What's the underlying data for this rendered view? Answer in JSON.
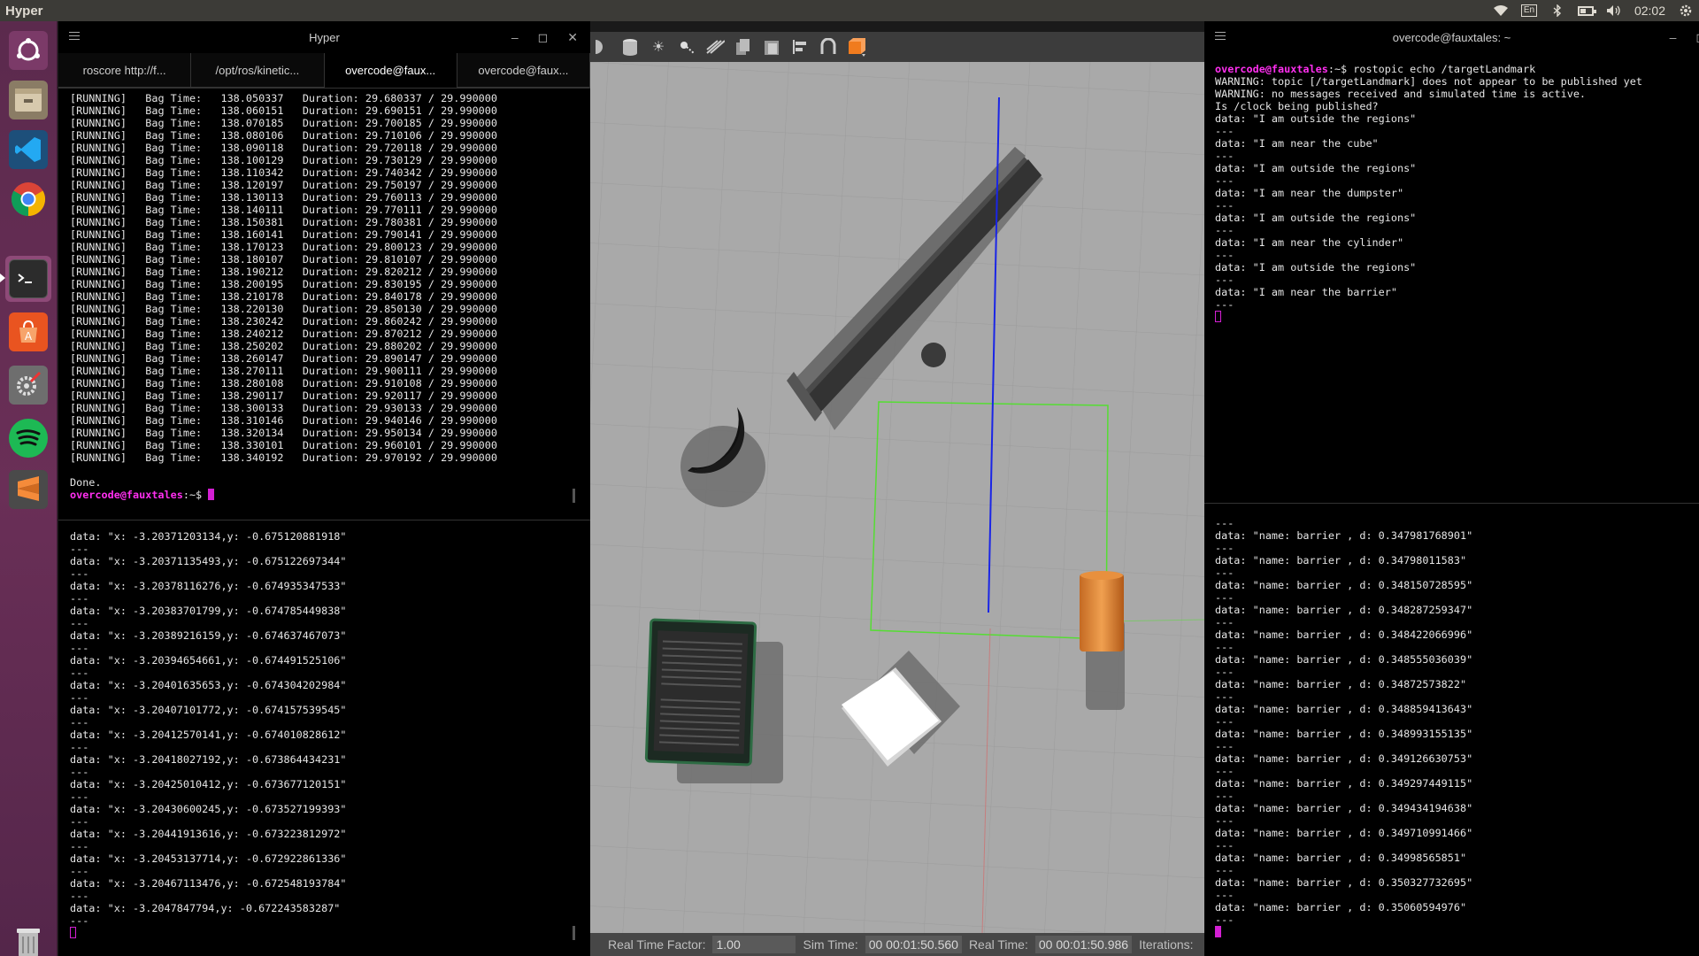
{
  "topbar": {
    "app_name": "Hyper",
    "time": "02:02",
    "keyboard": "En"
  },
  "launcher": {
    "items": [
      {
        "name": "ubuntu-dash-icon",
        "color": "#e95420"
      },
      {
        "name": "files-icon",
        "color": "#c8b99a"
      },
      {
        "name": "vscode-icon",
        "color": "#23a9f2"
      },
      {
        "name": "chrome-icon",
        "color": "#4285f4"
      },
      {
        "name": "terminal-icon",
        "color": "#2c2c2c"
      },
      {
        "name": "software-center-icon",
        "color": "#e95420"
      },
      {
        "name": "system-settings-icon",
        "color": "#9a9a9a"
      },
      {
        "name": "spotify-icon",
        "color": "#1db954"
      },
      {
        "name": "sublime-icon",
        "color": "#f58b3a"
      },
      {
        "name": "trash-icon",
        "color": "#cfcfcf"
      }
    ]
  },
  "left_window": {
    "title": "Hyper",
    "tabs": [
      {
        "label": "roscore http://f..."
      },
      {
        "label": "/opt/ros/kinetic..."
      },
      {
        "label": "overcode@faux..."
      },
      {
        "label": "overcode@faux..."
      }
    ],
    "top_pane": {
      "rows": [
        {
          "status": "[RUNNING]",
          "bag_label": "Bag Time:",
          "bag": "138.050337",
          "dur_label": "Duration:",
          "dur": "29.680337 / 29.990000"
        },
        {
          "status": "[RUNNING]",
          "bag_label": "Bag Time:",
          "bag": "138.060151",
          "dur_label": "Duration:",
          "dur": "29.690151 / 29.990000"
        },
        {
          "status": "[RUNNING]",
          "bag_label": "Bag Time:",
          "bag": "138.070185",
          "dur_label": "Duration:",
          "dur": "29.700185 / 29.990000"
        },
        {
          "status": "[RUNNING]",
          "bag_label": "Bag Time:",
          "bag": "138.080106",
          "dur_label": "Duration:",
          "dur": "29.710106 / 29.990000"
        },
        {
          "status": "[RUNNING]",
          "bag_label": "Bag Time:",
          "bag": "138.090118",
          "dur_label": "Duration:",
          "dur": "29.720118 / 29.990000"
        },
        {
          "status": "[RUNNING]",
          "bag_label": "Bag Time:",
          "bag": "138.100129",
          "dur_label": "Duration:",
          "dur": "29.730129 / 29.990000"
        },
        {
          "status": "[RUNNING]",
          "bag_label": "Bag Time:",
          "bag": "138.110342",
          "dur_label": "Duration:",
          "dur": "29.740342 / 29.990000"
        },
        {
          "status": "[RUNNING]",
          "bag_label": "Bag Time:",
          "bag": "138.120197",
          "dur_label": "Duration:",
          "dur": "29.750197 / 29.990000"
        },
        {
          "status": "[RUNNING]",
          "bag_label": "Bag Time:",
          "bag": "138.130113",
          "dur_label": "Duration:",
          "dur": "29.760113 / 29.990000"
        },
        {
          "status": "[RUNNING]",
          "bag_label": "Bag Time:",
          "bag": "138.140111",
          "dur_label": "Duration:",
          "dur": "29.770111 / 29.990000"
        },
        {
          "status": "[RUNNING]",
          "bag_label": "Bag Time:",
          "bag": "138.150381",
          "dur_label": "Duration:",
          "dur": "29.780381 / 29.990000"
        },
        {
          "status": "[RUNNING]",
          "bag_label": "Bag Time:",
          "bag": "138.160141",
          "dur_label": "Duration:",
          "dur": "29.790141 / 29.990000"
        },
        {
          "status": "[RUNNING]",
          "bag_label": "Bag Time:",
          "bag": "138.170123",
          "dur_label": "Duration:",
          "dur": "29.800123 / 29.990000"
        },
        {
          "status": "[RUNNING]",
          "bag_label": "Bag Time:",
          "bag": "138.180107",
          "dur_label": "Duration:",
          "dur": "29.810107 / 29.990000"
        },
        {
          "status": "[RUNNING]",
          "bag_label": "Bag Time:",
          "bag": "138.190212",
          "dur_label": "Duration:",
          "dur": "29.820212 / 29.990000"
        },
        {
          "status": "[RUNNING]",
          "bag_label": "Bag Time:",
          "bag": "138.200195",
          "dur_label": "Duration:",
          "dur": "29.830195 / 29.990000"
        },
        {
          "status": "[RUNNING]",
          "bag_label": "Bag Time:",
          "bag": "138.210178",
          "dur_label": "Duration:",
          "dur": "29.840178 / 29.990000"
        },
        {
          "status": "[RUNNING]",
          "bag_label": "Bag Time:",
          "bag": "138.220130",
          "dur_label": "Duration:",
          "dur": "29.850130 / 29.990000"
        },
        {
          "status": "[RUNNING]",
          "bag_label": "Bag Time:",
          "bag": "138.230242",
          "dur_label": "Duration:",
          "dur": "29.860242 / 29.990000"
        },
        {
          "status": "[RUNNING]",
          "bag_label": "Bag Time:",
          "bag": "138.240212",
          "dur_label": "Duration:",
          "dur": "29.870212 / 29.990000"
        },
        {
          "status": "[RUNNING]",
          "bag_label": "Bag Time:",
          "bag": "138.250202",
          "dur_label": "Duration:",
          "dur": "29.880202 / 29.990000"
        },
        {
          "status": "[RUNNING]",
          "bag_label": "Bag Time:",
          "bag": "138.260147",
          "dur_label": "Duration:",
          "dur": "29.890147 / 29.990000"
        },
        {
          "status": "[RUNNING]",
          "bag_label": "Bag Time:",
          "bag": "138.270111",
          "dur_label": "Duration:",
          "dur": "29.900111 / 29.990000"
        },
        {
          "status": "[RUNNING]",
          "bag_label": "Bag Time:",
          "bag": "138.280108",
          "dur_label": "Duration:",
          "dur": "29.910108 / 29.990000"
        },
        {
          "status": "[RUNNING]",
          "bag_label": "Bag Time:",
          "bag": "138.290117",
          "dur_label": "Duration:",
          "dur": "29.920117 / 29.990000"
        },
        {
          "status": "[RUNNING]",
          "bag_label": "Bag Time:",
          "bag": "138.300133",
          "dur_label": "Duration:",
          "dur": "29.930133 / 29.990000"
        },
        {
          "status": "[RUNNING]",
          "bag_label": "Bag Time:",
          "bag": "138.310146",
          "dur_label": "Duration:",
          "dur": "29.940146 / 29.990000"
        },
        {
          "status": "[RUNNING]",
          "bag_label": "Bag Time:",
          "bag": "138.320134",
          "dur_label": "Duration:",
          "dur": "29.950134 / 29.990000"
        },
        {
          "status": "[RUNNING]",
          "bag_label": "Bag Time:",
          "bag": "138.330101",
          "dur_label": "Duration:",
          "dur": "29.960101 / 29.990000"
        },
        {
          "status": "[RUNNING]",
          "bag_label": "Bag Time:",
          "bag": "138.340192",
          "dur_label": "Duration:",
          "dur": "29.970192 / 29.990000"
        }
      ],
      "done": "Done.",
      "prompt_user": "overcode@fauxtales",
      "prompt_suffix": ":~$ "
    },
    "bottom_pane": {
      "lines": [
        "data: \"x: -3.20371203134,y: -0.675120881918\"",
        "---",
        "data: \"x: -3.20371135493,y: -0.675122697344\"",
        "---",
        "data: \"x: -3.20378116276,y: -0.674935347533\"",
        "---",
        "data: \"x: -3.20383701799,y: -0.674785449838\"",
        "---",
        "data: \"x: -3.20389216159,y: -0.674637467073\"",
        "---",
        "data: \"x: -3.20394654661,y: -0.674491525106\"",
        "---",
        "data: \"x: -3.20401635653,y: -0.674304202984\"",
        "---",
        "data: \"x: -3.20407101772,y: -0.674157539545\"",
        "---",
        "data: \"x: -3.20412570141,y: -0.674010828612\"",
        "---",
        "data: \"x: -3.20418027192,y: -0.673864434231\"",
        "---",
        "data: \"x: -3.20425010412,y: -0.673677120151\"",
        "---",
        "data: \"x: -3.20430600245,y: -0.673527199393\"",
        "---",
        "data: \"x: -3.20441913616,y: -0.673223812972\"",
        "---",
        "data: \"x: -3.20453137714,y: -0.672922861336\"",
        "---",
        "data: \"x: -3.20467113476,y: -0.672548193784\"",
        "---",
        "data: \"x: -3.2047847794,y: -0.672243583287\"",
        "---"
      ]
    }
  },
  "gazebo": {
    "status": {
      "rtf_label": "Real Time Factor:",
      "rtf_value": "1.00",
      "sim_label": "Sim Time:",
      "sim_value": "00 00:01:50.560",
      "real_label": "Real Time:",
      "real_value": "00 00:01:50.986",
      "iter_label": "Iterations:"
    }
  },
  "right_window": {
    "title": "overcode@fauxtales: ~",
    "top_pane": {
      "prompt_user": "overcode@fauxtales",
      "command": ":~$ rostopic echo /targetLandmark",
      "lines": [
        "WARNING: topic [/targetLandmark] does not appear to be published yet",
        "WARNING: no messages received and simulated time is active.",
        "Is /clock being published?",
        "data: \"I am outside the regions\"",
        "---",
        "data: \"I am near the cube\"",
        "---",
        "data: \"I am outside the regions\"",
        "---",
        "data: \"I am near the dumpster\"",
        "---",
        "data: \"I am outside the regions\"",
        "---",
        "data: \"I am near the cylinder\"",
        "---",
        "data: \"I am outside the regions\"",
        "---",
        "data: \"I am near the barrier\"",
        "---"
      ]
    },
    "bottom_pane": {
      "lines": [
        "---",
        "data: \"name: barrier , d: 0.347981768901\"",
        "---",
        "data: \"name: barrier , d: 0.34798011583\"",
        "---",
        "data: \"name: barrier , d: 0.348150728595\"",
        "---",
        "data: \"name: barrier , d: 0.348287259347\"",
        "---",
        "data: \"name: barrier , d: 0.348422066996\"",
        "---",
        "data: \"name: barrier , d: 0.348555036039\"",
        "---",
        "data: \"name: barrier , d: 0.34872573822\"",
        "---",
        "data: \"name: barrier , d: 0.348859413643\"",
        "---",
        "data: \"name: barrier , d: 0.348993155135\"",
        "---",
        "data: \"name: barrier , d: 0.349126630753\"",
        "---",
        "data: \"name: barrier , d: 0.349297449115\"",
        "---",
        "data: \"name: barrier , d: 0.349434194638\"",
        "---",
        "data: \"name: barrier , d: 0.349710991466\"",
        "---",
        "data: \"name: barrier , d: 0.34998565851\"",
        "---",
        "data: \"name: barrier , d: 0.350327732695\"",
        "---",
        "data: \"name: barrier , d: 0.35060594976\"",
        "---"
      ]
    }
  },
  "colors": {
    "prompt": "#ff2ff0",
    "launcher": "#5b2a4d",
    "gazebo_ground": "#a9a9a9"
  }
}
